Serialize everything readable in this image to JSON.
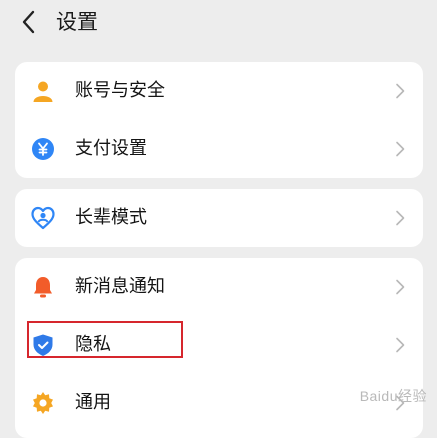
{
  "header": {
    "title": "设置",
    "back_icon": "chevron-left-icon"
  },
  "groups": [
    {
      "items": [
        {
          "label": "账号与安全",
          "icon": "person-icon",
          "color": "#f5a623"
        },
        {
          "label": "支付设置",
          "icon": "yuan-coin-icon",
          "color": "#2f86f6"
        }
      ]
    },
    {
      "items": [
        {
          "label": "长辈模式",
          "icon": "heart-person-icon",
          "color": "#2f86f6"
        }
      ]
    },
    {
      "items": [
        {
          "label": "新消息通知",
          "icon": "bell-icon",
          "color": "#f25c2a"
        },
        {
          "label": "隐私",
          "icon": "shield-check-icon",
          "color": "#2f7ae8",
          "highlighted": true
        },
        {
          "label": "通用",
          "icon": "gear-icon",
          "color": "#f5a623"
        }
      ]
    }
  ],
  "highlight_color": "#d6262d",
  "watermark": "Baidu经验"
}
